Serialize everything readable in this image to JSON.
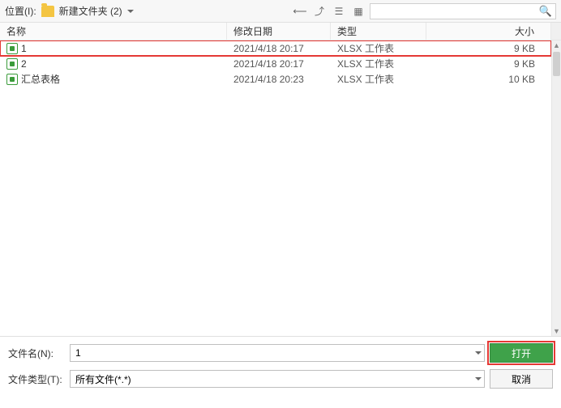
{
  "topbar": {
    "location_label": "位置(I):",
    "folder_name": "新建文件夹 (2)"
  },
  "columns": {
    "name": "名称",
    "date": "修改日期",
    "type": "类型",
    "size": "大小"
  },
  "files": [
    {
      "name": "1",
      "date": "2021/4/18 20:17",
      "type": "XLSX 工作表",
      "size": "9 KB",
      "highlighted": true
    },
    {
      "name": "2",
      "date": "2021/4/18 20:17",
      "type": "XLSX 工作表",
      "size": "9 KB",
      "highlighted": false
    },
    {
      "name": "汇总表格",
      "date": "2021/4/18 20:23",
      "type": "XLSX 工作表",
      "size": "10 KB",
      "highlighted": false
    }
  ],
  "form": {
    "filename_label": "文件名(N):",
    "filename_value": "1",
    "filetype_label": "文件类型(T):",
    "filetype_value": "所有文件(*.*)"
  },
  "buttons": {
    "open": "打开",
    "cancel": "取消"
  }
}
